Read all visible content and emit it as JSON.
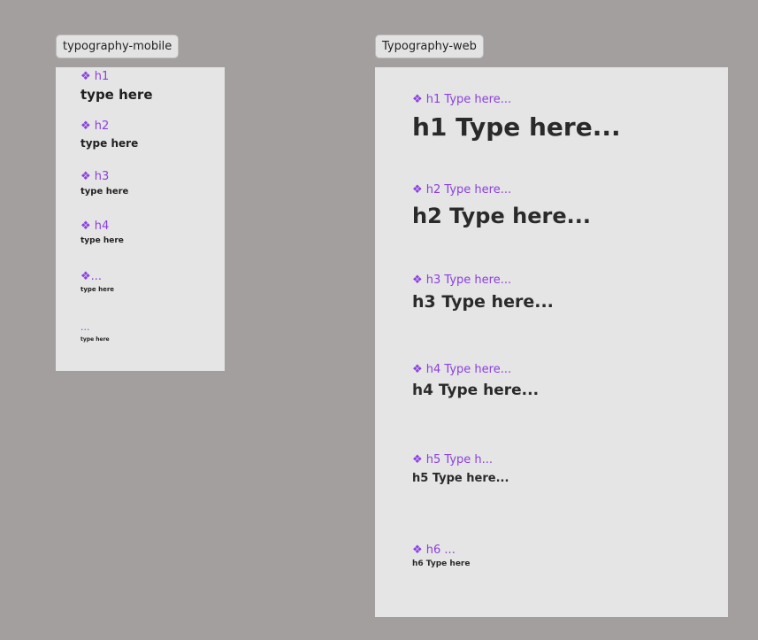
{
  "frames": {
    "mobile": {
      "title": "typography-mobile",
      "items": [
        {
          "label": "❖ h1",
          "text": "type here"
        },
        {
          "label": "❖ h2",
          "text": "type here"
        },
        {
          "label": "❖ h3",
          "text": "type here"
        },
        {
          "label": "❖ h4",
          "text": "type here"
        },
        {
          "label": "❖...",
          "text": "type here"
        },
        {
          "label": "...",
          "text": "type here"
        }
      ]
    },
    "web": {
      "title": "Typography-web",
      "items": [
        {
          "label": "❖ h1 Type here...",
          "text": "h1 Type here..."
        },
        {
          "label": "❖ h2 Type here...",
          "text": "h2 Type here..."
        },
        {
          "label": "❖ h3 Type here...",
          "text": "h3 Type here..."
        },
        {
          "label": "❖ h4 Type here...",
          "text": "h4 Type here..."
        },
        {
          "label": "❖ h5 Type h...",
          "text": "h5 Type here..."
        },
        {
          "label": "❖ h6 ...",
          "text": "h6 Type here"
        }
      ]
    }
  },
  "colors": {
    "canvas": "#a29f9e",
    "frame": "#e5e5e5",
    "component_label": "#8b3fe0",
    "sample_text": "#1f1f1f"
  }
}
